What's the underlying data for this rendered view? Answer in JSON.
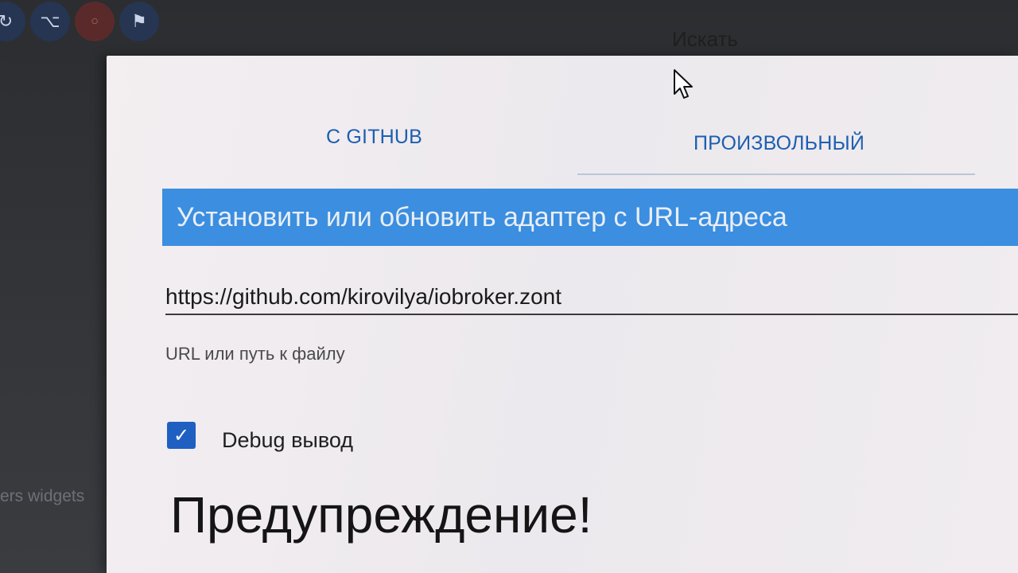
{
  "top_icons": [
    {
      "icon": "refresh-icon",
      "glyph": "↻"
    },
    {
      "icon": "github-icon",
      "glyph": "⌥"
    },
    {
      "icon": "notification-icon",
      "glyph": "○"
    },
    {
      "icon": "flag-icon",
      "glyph": "⚑"
    }
  ],
  "background": {
    "left_panel_text": "ers widgets"
  },
  "search": {
    "label": "Искать"
  },
  "dialog": {
    "tabs": [
      {
        "label": "С GITHUB",
        "active": false
      },
      {
        "label": "ПРОИЗВОЛЬНЫЙ",
        "active": true
      }
    ],
    "banner_title": "Установить или обновить адаптер с URL-адреса",
    "url_input": {
      "value": "https://github.com/kirovilya/iobroker.zont",
      "helper": "URL или путь к файлу"
    },
    "debug_checkbox": {
      "checked": true,
      "label": "Debug вывод",
      "check_glyph": "✓"
    },
    "warning_title": "Предупреждение!"
  },
  "colors": {
    "accent": "#3b8ee0",
    "tab_text": "#1d5fb0",
    "checkbox": "#1f5fc2"
  }
}
